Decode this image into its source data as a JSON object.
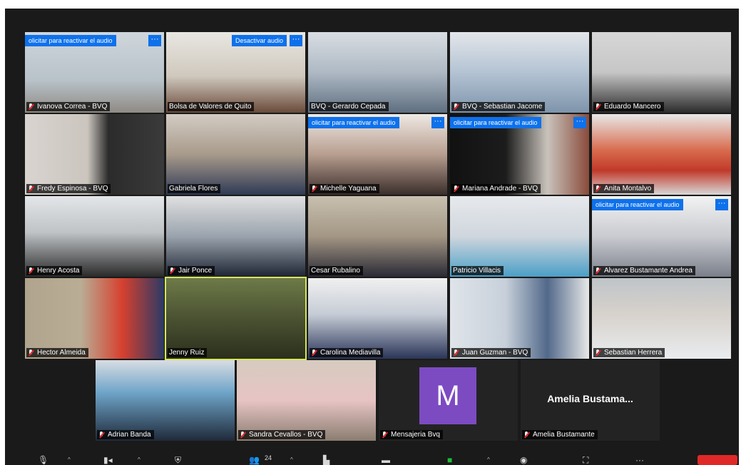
{
  "tiles": [
    {
      "name": "Ivanova Correa - BVQ",
      "request": "olicitar para reactivar el audio",
      "bg": "linear-gradient(180deg,#cfd6dc 0%,#b8c2c9 60%,#8f8a84 100%)"
    },
    {
      "name": "Bolsa de Valores de Quito",
      "request": "Desactivar audio",
      "bg": "linear-gradient(180deg,#e9e7e2 0%,#cfc8bd 55%,#6a4a3a 100%)"
    },
    {
      "name": "BVQ - Gerardo Cepada",
      "request": "",
      "bg": "linear-gradient(180deg,#d8dde2 0%,#aeb9c4 50%,#5f6f80 100%)"
    },
    {
      "name": "BVQ - Sebastian Jacome",
      "request": "",
      "bg": "linear-gradient(180deg,#e3e6ea 0%,#b4c3d3 50%,#7e94ab 100%)"
    },
    {
      "name": "Eduardo Mancero",
      "request": "",
      "bg": "linear-gradient(180deg,#d7d7d7 0%,#c6c6c6 50%,#2c2c2c 100%)"
    },
    {
      "name": "Fredy Espinosa - BVQ",
      "request": "",
      "bg": "linear-gradient(90deg,#d9d4d0 0%,#cbc5be 45%,#2b2b2b 60%,#3a3a3a 100%)"
    },
    {
      "name": "Gabriela Flores",
      "request": "",
      "bg": "linear-gradient(180deg,#d3ccc4 0%,#a89a8b 50%,#2f3a55 100%)"
    },
    {
      "name": "Michelle Yaguana",
      "request": "olicitar para reactivar el audio",
      "bg": "linear-gradient(180deg,#efe9e4 0%,#b79e8f 50%,#3b2e2b 100%)"
    },
    {
      "name": "Mariana Andrade - BVQ",
      "request": "olicitar para reactivar el audio",
      "bg": "linear-gradient(90deg,#111 0%,#1c1c1c 40%,#c9c3bb 70%,#8a4b3b 100%)"
    },
    {
      "name": "Anita Montalvo",
      "request": "",
      "bg": "linear-gradient(180deg,#e8e8e8 0%,#d86b4d 45%,#c13a2a 70%,#d8d8d8 100%)"
    },
    {
      "name": "Henry Acosta",
      "request": "",
      "bg": "linear-gradient(180deg,#e4e6e8 0%,#bfc3c6 45%,#2a2a2a 100%)"
    },
    {
      "name": "Jair Ponce",
      "request": "",
      "bg": "linear-gradient(180deg,#e0e0e0 0%,#9aa3ad 50%,#1e2433 100%)"
    },
    {
      "name": "Cesar Rubalino",
      "request": "",
      "bg": "linear-gradient(180deg,#c8c0b0 0%,#a39684 50%,#2a2a35 100%)"
    },
    {
      "name": "Patricio Villacis",
      "request": "",
      "bg": "linear-gradient(180deg,#e7e9ec 0%,#cfd6dd 50%,#4b9fc7 100%)"
    },
    {
      "name": "Alvarez Bustamante Andrea",
      "request": "olicitar para reactivar el audio",
      "bg": "linear-gradient(180deg,#f2f2f2 0%,#c9cbd0 50%,#7a7f8a 100%)"
    },
    {
      "name": "Hector Almeida",
      "request": "",
      "bg": "linear-gradient(90deg,#b0a48e 0%,#b9ad95 40%,#d6402e 70%,#2c3a66 100%)"
    },
    {
      "name": "Jenny Ruiz",
      "request": "",
      "bg": "linear-gradient(180deg,#6e7a48 0%,#4a5232 50%,#2b2f1c 100%)",
      "selected": true
    },
    {
      "name": "Carolina Mediavilla",
      "request": "",
      "bg": "linear-gradient(180deg,#f0f0f0 0%,#c6ccd6 45%,#2a3558 100%)"
    },
    {
      "name": "Juan Guzman - BVQ",
      "request": "",
      "bg": "linear-gradient(90deg,#dfe4ea 0%,#c7d0da 40%,#52698a 70%,#e8e8e8 100%)"
    },
    {
      "name": "Sebastian Herrera",
      "request": "",
      "bg": "linear-gradient(180deg,#bfc4c8 0%,#d7d2cc 45%,#e9ecef 100%)"
    },
    {
      "name": "Adrian Banda",
      "request": "",
      "bg": "linear-gradient(180deg,#d8dde3 0%,#6fa5c9 40%,#1f2a3a 100%)"
    },
    {
      "name": "Sandra Cevallos - BVQ",
      "request": "",
      "bg": "linear-gradient(180deg,#d6cbbf 0%,#e7c4c4 50%,#8b7d70 100%)"
    },
    {
      "name": "Mensajeria Bvq",
      "request": "",
      "avatar": "M",
      "bg": "#232323"
    },
    {
      "name": "Amelia Bustamante",
      "request": "",
      "bigname": "Amelia  Bustama...",
      "bg": "#232323"
    }
  ],
  "more_label": "···",
  "toolbar": {
    "participants_count": "24",
    "icons": [
      "mute-icon",
      "video-icon",
      "security-icon",
      "participants-icon",
      "polls-icon",
      "chat-icon",
      "share-screen-icon",
      "record-icon",
      "breakout-icon",
      "more-icon"
    ]
  }
}
